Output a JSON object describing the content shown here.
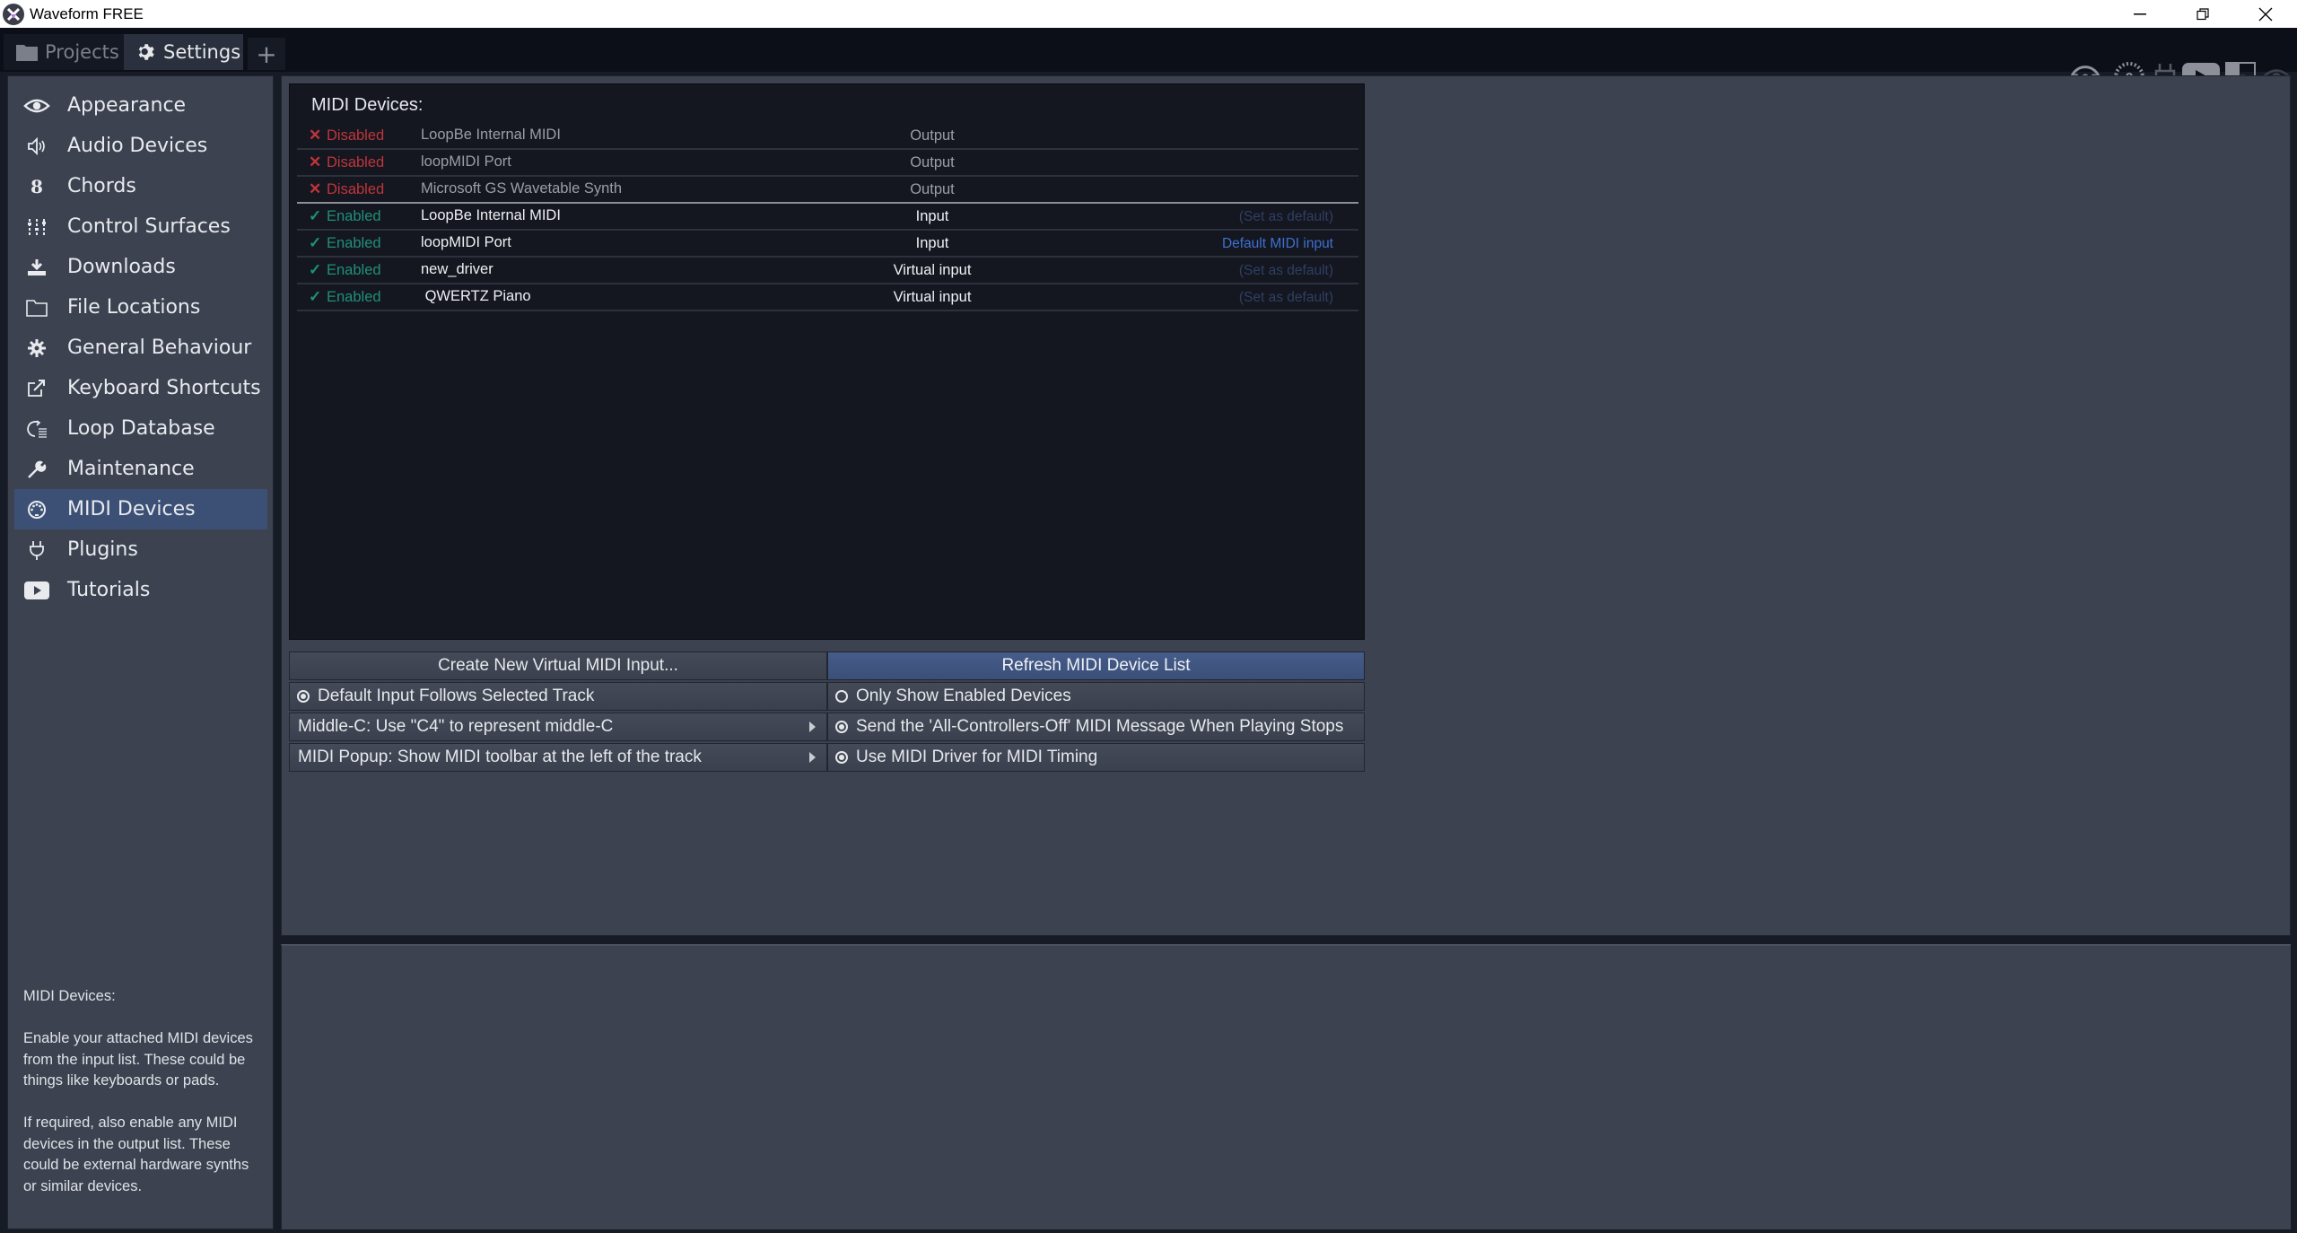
{
  "window": {
    "title": "Waveform FREE",
    "controls": {
      "minimize": "—",
      "restore": "❐",
      "close": "✕"
    }
  },
  "tabs": [
    {
      "label": "Projects",
      "icon": "folder-icon",
      "active": false
    },
    {
      "label": "Settings",
      "icon": "gear-icon",
      "active": true
    }
  ],
  "add_tab_label": "+",
  "toolbar": {
    "cpu_meter_value": "100",
    "voice_meter_value": "0",
    "icons": [
      "plug-icon",
      "play-video-icon",
      "resize-icon",
      "eye-icon"
    ]
  },
  "sidebar": {
    "items": [
      {
        "label": "Appearance",
        "icon": "eye-icon",
        "active": false
      },
      {
        "label": "Audio Devices",
        "icon": "speaker-icon",
        "active": false
      },
      {
        "label": "Chords",
        "icon": "chord-icon",
        "active": false
      },
      {
        "label": "Control Surfaces",
        "icon": "sliders-icon",
        "active": false
      },
      {
        "label": "Downloads",
        "icon": "download-icon",
        "active": false
      },
      {
        "label": "File Locations",
        "icon": "folder-icon",
        "active": false
      },
      {
        "label": "General Behaviour",
        "icon": "gear-icon",
        "active": false
      },
      {
        "label": "Keyboard Shortcuts",
        "icon": "external-link-icon",
        "active": false
      },
      {
        "label": "Loop Database",
        "icon": "loop-database-icon",
        "active": false
      },
      {
        "label": "Maintenance",
        "icon": "wrench-icon",
        "active": false
      },
      {
        "label": "MIDI Devices",
        "icon": "midi-icon",
        "active": true
      },
      {
        "label": "Plugins",
        "icon": "plug-icon",
        "active": false
      },
      {
        "label": "Tutorials",
        "icon": "video-icon",
        "active": false
      }
    ],
    "help": {
      "title": "MIDI Devices:",
      "paragraphs": [
        "Enable your attached MIDI devices from the input list. These could be things like keyboards or pads.",
        "If required, also enable any MIDI devices in the output list. These could be external hardware synths or similar devices."
      ]
    }
  },
  "midi_list": {
    "header": "MIDI Devices:",
    "devices": [
      {
        "status": "Disabled",
        "name": "LoopBe Internal MIDI",
        "type": "Output",
        "default": ""
      },
      {
        "status": "Disabled",
        "name": "loopMIDI Port",
        "type": "Output",
        "default": ""
      },
      {
        "status": "Disabled",
        "name": "Microsoft GS Wavetable Synth",
        "type": "Output",
        "default": ""
      },
      {
        "status": "Enabled",
        "name": "LoopBe Internal MIDI",
        "type": "Input",
        "default": "(Set as default)"
      },
      {
        "status": "Enabled",
        "name": "loopMIDI Port",
        "type": "Input",
        "default": "Default MIDI input"
      },
      {
        "status": "Enabled",
        "name": "new_driver",
        "type": "Virtual input",
        "default": "(Set as default)"
      },
      {
        "status": "Enabled",
        "name": " QWERTZ Piano",
        "type": "Virtual input",
        "default": "(Set as default)"
      }
    ]
  },
  "controls": {
    "create_virtual": "Create New Virtual MIDI Input...",
    "refresh": "Refresh MIDI Device List",
    "default_follows_track": {
      "label": "Default Input Follows Selected Track",
      "checked": true
    },
    "only_show_enabled": {
      "label": "Only Show Enabled Devices",
      "checked": false
    },
    "middle_c": {
      "label": "Middle-C: Use \"C4\" to represent middle-C"
    },
    "all_controllers_off": {
      "label": "Send the 'All-Controllers-Off' MIDI Message When Playing Stops",
      "checked": true
    },
    "midi_popup": {
      "label": "MIDI Popup: Show MIDI toolbar at the left of the track"
    },
    "midi_driver_timing": {
      "label": "Use MIDI Driver for MIDI Timing",
      "checked": true
    }
  },
  "colors": {
    "disabled": "#c0353a",
    "enabled": "#1f8f7a",
    "accent": "#3c5075",
    "default_link": "#3f6fd0"
  }
}
